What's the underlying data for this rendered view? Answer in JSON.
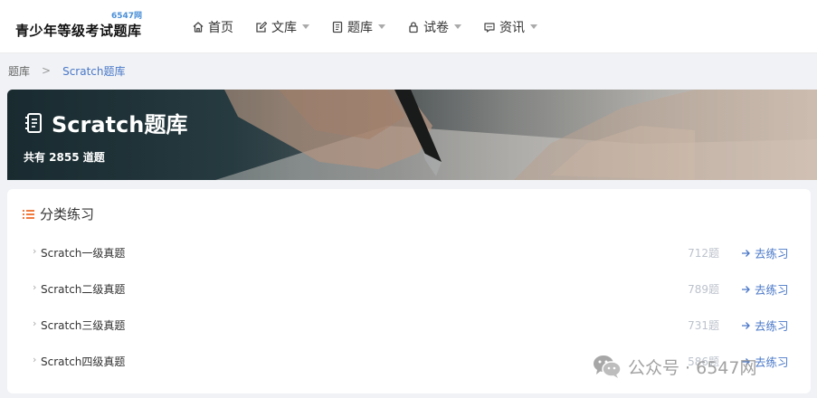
{
  "logo": {
    "title": "青少年等级考试题库",
    "badge": "6547网"
  },
  "nav": [
    {
      "label": "首页",
      "icon": "home-icon",
      "dropdown": false
    },
    {
      "label": "文库",
      "icon": "edit-icon",
      "dropdown": true
    },
    {
      "label": "题库",
      "icon": "notebook-icon",
      "dropdown": true
    },
    {
      "label": "试卷",
      "icon": "lock-icon",
      "dropdown": true
    },
    {
      "label": "资讯",
      "icon": "chat-icon",
      "dropdown": true
    }
  ],
  "breadcrumb": {
    "root": "题库",
    "separator": ">",
    "current": "Scratch题库"
  },
  "banner": {
    "title": "Scratch题库",
    "count_text": "共有 2855 道题"
  },
  "card": {
    "title": "分类练习",
    "rows": [
      {
        "name": "Scratch一级真题",
        "count": "712题",
        "action": "去练习"
      },
      {
        "name": "Scratch二级真题",
        "count": "789题",
        "action": "去练习"
      },
      {
        "name": "Scratch三级真题",
        "count": "731题",
        "action": "去练习"
      },
      {
        "name": "Scratch四级真题",
        "count": "586题",
        "action": "去练习"
      }
    ]
  },
  "watermark": {
    "text": "公众号 · 6547网"
  },
  "colors": {
    "accent": "#4a78c8",
    "title_icon": "#f07b3f",
    "count": "#bcc2cc"
  }
}
